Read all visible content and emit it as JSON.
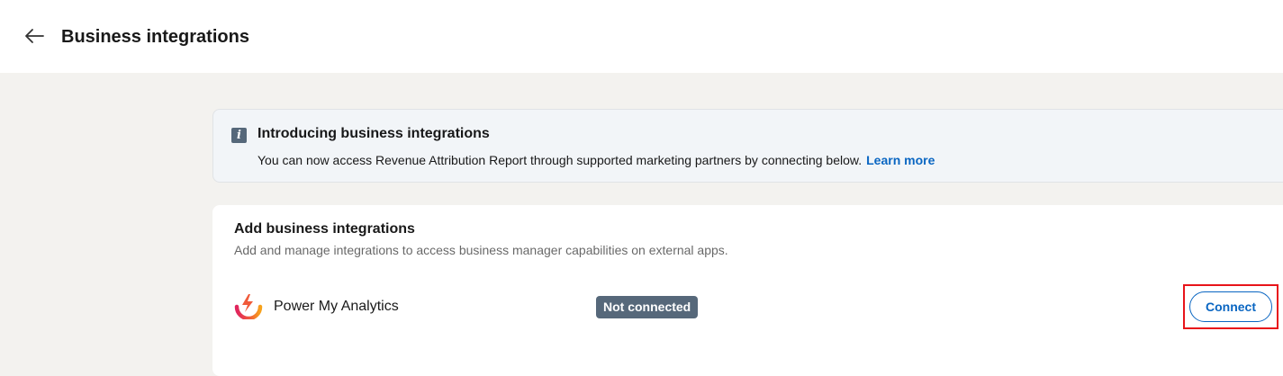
{
  "header": {
    "back_icon": "arrow-left-icon",
    "title": "Business integrations"
  },
  "banner": {
    "icon": "info-icon",
    "icon_glyph": "i",
    "title": "Introducing business integrations",
    "text": "You can now access Revenue Attribution Report through supported marketing partners by connecting below.",
    "link_label": "Learn more"
  },
  "integrations": {
    "title": "Add business integrations",
    "subtitle": "Add and manage integrations to access business manager capabilities on external apps.",
    "items": [
      {
        "name": "Power My Analytics",
        "logo_icon": "power-my-analytics-logo",
        "status": "Not connected",
        "action_label": "Connect"
      }
    ]
  },
  "colors": {
    "accent": "#0a66c2",
    "badge_bg": "#56687a",
    "page_bg": "#f3f2ef",
    "highlight": "#e8141a"
  }
}
